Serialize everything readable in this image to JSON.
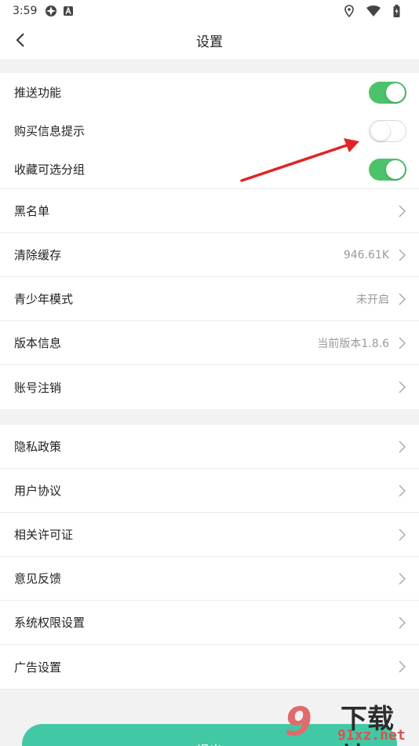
{
  "status_bar": {
    "time": "3:59",
    "icons_left": [
      "app-icon",
      "a-square-icon"
    ],
    "icons_right": [
      "location-icon",
      "wifi-icon",
      "battery-icon"
    ]
  },
  "header": {
    "title": "设置"
  },
  "toggles": [
    {
      "label": "推送功能",
      "state": true
    },
    {
      "label": "购买信息提示",
      "state": false
    },
    {
      "label": "收藏可选分组",
      "state": true
    }
  ],
  "group1": [
    {
      "label": "黑名单",
      "value": ""
    },
    {
      "label": "清除缓存",
      "value": "946.61K"
    },
    {
      "label": "青少年模式",
      "value": "未开启"
    },
    {
      "label": "版本信息",
      "value": "当前版本1.8.6"
    },
    {
      "label": "账号注销",
      "value": ""
    }
  ],
  "group2": [
    {
      "label": "隐私政策"
    },
    {
      "label": "用户协议"
    },
    {
      "label": "相关许可证"
    },
    {
      "label": "意见反馈"
    },
    {
      "label": "系统权限设置"
    },
    {
      "label": "广告设置"
    }
  ],
  "logout": {
    "label": "退出"
  },
  "watermark": {
    "logo": "9",
    "text": "下载站",
    "url": "91xz.net"
  },
  "colors": {
    "toggle_on": "#4cc36a",
    "logout_bg": "#43c8a5",
    "arrow": "#e02424"
  }
}
